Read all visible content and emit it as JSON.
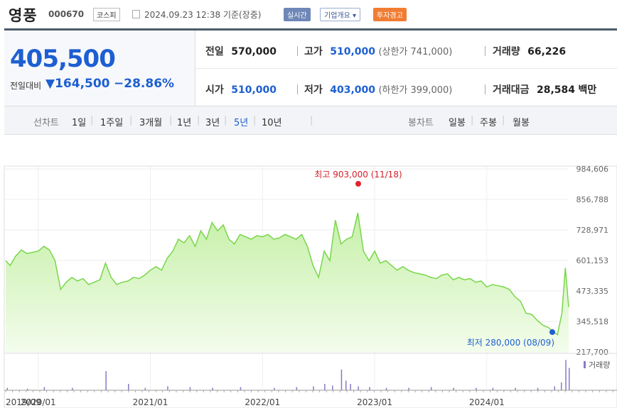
{
  "stock": {
    "name": "영풍",
    "code": "000670",
    "market": "코스피",
    "datetime": "2024.09.23 12:38 기준(장중)",
    "badges": {
      "realtime": "실시간",
      "company": "기업개요 ▾",
      "warning": "투자경고"
    }
  },
  "price": {
    "current": "405,500",
    "change_label": "전일대비",
    "change_arrow": "▼",
    "change_value": "164,500",
    "change_pct": "−28.86%"
  },
  "summary": {
    "prev_close_label": "전일",
    "prev_close": "570,000",
    "high_label": "고가",
    "high": "510,000",
    "upper_limit": "(상한가 741,000)",
    "volume_label": "거래량",
    "volume": "66,226",
    "open_label": "시가",
    "open": "510,000",
    "low_label": "저가",
    "low": "403,000",
    "lower_limit": "(하한가 399,000)",
    "amount_label": "거래대금",
    "amount": "28,584",
    "amount_unit": "백만"
  },
  "periods": {
    "line_label": "선차트",
    "line_items": [
      "1일",
      "1주일",
      "3개월",
      "1년",
      "3년",
      "5년",
      "10년"
    ],
    "active_index": 5,
    "candle_label": "봉차트",
    "candle_items": [
      "일봉",
      "주봉",
      "월봉"
    ]
  },
  "chart_data": {
    "type": "area",
    "y_ticks": [
      "984,606",
      "856,788",
      "728,971",
      "601,153",
      "473,335",
      "345,518",
      "217,700"
    ],
    "ylim": [
      217700,
      984606
    ],
    "x_ticks": [
      "2019/09",
      "2020/01",
      "2021/01",
      "2022/01",
      "2023/01",
      "2024/01"
    ],
    "x_tick_dates": [
      2019.71,
      2020.0,
      2021.0,
      2022.0,
      2023.0,
      2024.0
    ],
    "xlim": [
      2019.71,
      2024.73
    ],
    "high_annotation": "최고 903,000 (11/18)",
    "low_annotation": "최저 280,000 (08/09)",
    "volume_label": "거래량",
    "series": [
      {
        "values": [
          [
            2019.71,
            600000
          ],
          [
            2019.75,
            580000
          ],
          [
            2019.8,
            620000
          ],
          [
            2019.85,
            645000
          ],
          [
            2019.9,
            630000
          ],
          [
            2020.0,
            640000
          ],
          [
            2020.05,
            660000
          ],
          [
            2020.1,
            645000
          ],
          [
            2020.15,
            600000
          ],
          [
            2020.2,
            480000
          ],
          [
            2020.25,
            510000
          ],
          [
            2020.3,
            530000
          ],
          [
            2020.35,
            515000
          ],
          [
            2020.4,
            525000
          ],
          [
            2020.45,
            500000
          ],
          [
            2020.5,
            510000
          ],
          [
            2020.55,
            520000
          ],
          [
            2020.6,
            590000
          ],
          [
            2020.65,
            530000
          ],
          [
            2020.7,
            500000
          ],
          [
            2020.75,
            510000
          ],
          [
            2020.8,
            515000
          ],
          [
            2020.85,
            530000
          ],
          [
            2020.9,
            525000
          ],
          [
            2020.95,
            540000
          ],
          [
            2021.0,
            560000
          ],
          [
            2021.05,
            575000
          ],
          [
            2021.1,
            560000
          ],
          [
            2021.15,
            610000
          ],
          [
            2021.2,
            640000
          ],
          [
            2021.25,
            690000
          ],
          [
            2021.3,
            675000
          ],
          [
            2021.35,
            705000
          ],
          [
            2021.4,
            660000
          ],
          [
            2021.45,
            725000
          ],
          [
            2021.5,
            690000
          ],
          [
            2021.55,
            760000
          ],
          [
            2021.6,
            725000
          ],
          [
            2021.65,
            750000
          ],
          [
            2021.7,
            690000
          ],
          [
            2021.75,
            670000
          ],
          [
            2021.8,
            710000
          ],
          [
            2021.85,
            700000
          ],
          [
            2021.9,
            690000
          ],
          [
            2021.95,
            705000
          ],
          [
            2022.0,
            700000
          ],
          [
            2022.05,
            710000
          ],
          [
            2022.1,
            690000
          ],
          [
            2022.15,
            695000
          ],
          [
            2022.2,
            710000
          ],
          [
            2022.25,
            700000
          ],
          [
            2022.3,
            690000
          ],
          [
            2022.35,
            710000
          ],
          [
            2022.4,
            660000
          ],
          [
            2022.45,
            580000
          ],
          [
            2022.5,
            530000
          ],
          [
            2022.55,
            640000
          ],
          [
            2022.6,
            600000
          ],
          [
            2022.65,
            770000
          ],
          [
            2022.7,
            670000
          ],
          [
            2022.75,
            690000
          ],
          [
            2022.8,
            700000
          ],
          [
            2022.85,
            800000
          ],
          [
            2022.9,
            640000
          ],
          [
            2022.95,
            600000
          ],
          [
            2023.0,
            640000
          ],
          [
            2023.05,
            590000
          ],
          [
            2023.1,
            600000
          ],
          [
            2023.15,
            580000
          ],
          [
            2023.2,
            560000
          ],
          [
            2023.25,
            575000
          ],
          [
            2023.3,
            560000
          ],
          [
            2023.35,
            550000
          ],
          [
            2023.4,
            545000
          ],
          [
            2023.45,
            540000
          ],
          [
            2023.5,
            530000
          ],
          [
            2023.55,
            525000
          ],
          [
            2023.6,
            540000
          ],
          [
            2023.65,
            545000
          ],
          [
            2023.7,
            520000
          ],
          [
            2023.75,
            530000
          ],
          [
            2023.8,
            520000
          ],
          [
            2023.85,
            525000
          ],
          [
            2023.9,
            510000
          ],
          [
            2023.95,
            515000
          ],
          [
            2024.0,
            490000
          ],
          [
            2024.05,
            500000
          ],
          [
            2024.1,
            495000
          ],
          [
            2024.15,
            490000
          ],
          [
            2024.2,
            480000
          ],
          [
            2024.25,
            450000
          ],
          [
            2024.3,
            430000
          ],
          [
            2024.35,
            380000
          ],
          [
            2024.4,
            375000
          ],
          [
            2024.45,
            350000
          ],
          [
            2024.5,
            330000
          ],
          [
            2024.55,
            320000
          ],
          [
            2024.6,
            300000
          ],
          [
            2024.63,
            290000
          ],
          [
            2024.67,
            380000
          ],
          [
            2024.7,
            570000
          ],
          [
            2024.73,
            405500
          ]
        ]
      }
    ],
    "volume": [
      [
        2019.72,
        3
      ],
      [
        2019.9,
        2
      ],
      [
        2020.05,
        4
      ],
      [
        2020.3,
        3
      ],
      [
        2020.6,
        24
      ],
      [
        2020.8,
        8
      ],
      [
        2020.95,
        3
      ],
      [
        2021.15,
        5
      ],
      [
        2021.35,
        4
      ],
      [
        2021.55,
        3
      ],
      [
        2021.8,
        4
      ],
      [
        2022.1,
        3
      ],
      [
        2022.3,
        4
      ],
      [
        2022.45,
        5
      ],
      [
        2022.55,
        8
      ],
      [
        2022.62,
        6
      ],
      [
        2022.7,
        26
      ],
      [
        2022.74,
        12
      ],
      [
        2022.78,
        8
      ],
      [
        2022.85,
        5
      ],
      [
        2022.95,
        4
      ],
      [
        2023.1,
        3
      ],
      [
        2023.3,
        3
      ],
      [
        2023.5,
        4
      ],
      [
        2023.7,
        3
      ],
      [
        2023.9,
        3
      ],
      [
        2024.05,
        3
      ],
      [
        2024.25,
        3
      ],
      [
        2024.45,
        3
      ],
      [
        2024.6,
        5
      ],
      [
        2024.66,
        10
      ],
      [
        2024.7,
        38
      ],
      [
        2024.73,
        28
      ]
    ]
  }
}
